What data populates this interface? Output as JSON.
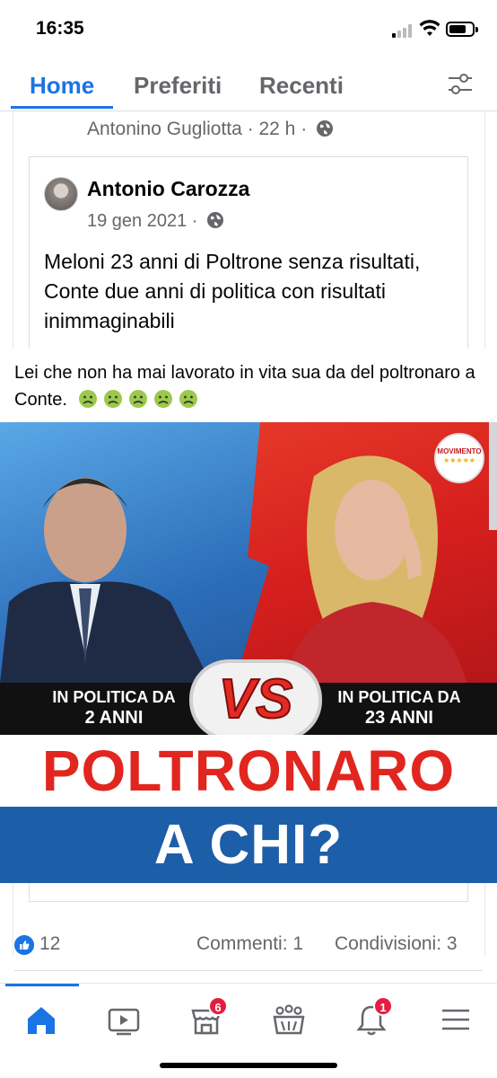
{
  "status_bar": {
    "time": "16:35"
  },
  "tabs": {
    "items": [
      {
        "label": "Home",
        "active": true
      },
      {
        "label": "Preferiti",
        "active": false
      },
      {
        "label": "Recenti",
        "active": false
      }
    ],
    "filter_icon": "sliders-icon"
  },
  "post": {
    "sharer": "Antonino Gugliotta",
    "sharer_time": "22 h",
    "shared": {
      "author": "Antonio Carozza",
      "date": "19 gen 2021",
      "text": "Meloni 23 anni di Poltrone senza risultati, Conte due anni di politica con risultati inimmaginabili",
      "caption": "Lei che non ha mai lavorato in vita sua da del poltronaro a Conte.",
      "caption_emoji_count": 5,
      "image": {
        "left_line1": "IN POLITICA DA",
        "left_line2": "2 ANNI",
        "right_line1": "IN POLITICA DA",
        "right_line2": "23 ANNI",
        "vs": "VS",
        "headline1": "POLTRONARO",
        "headline2": "A CHI?",
        "logo_text": "MOVIMENTO"
      }
    },
    "reactions": {
      "likes": "12",
      "comments": "Commenti: 1",
      "shares": "Condivisioni: 3"
    }
  },
  "bottom_nav": {
    "items": [
      {
        "icon": "home-icon",
        "active": true
      },
      {
        "icon": "video-icon"
      },
      {
        "icon": "marketplace-icon",
        "badge": "6"
      },
      {
        "icon": "groups-icon"
      },
      {
        "icon": "bell-icon",
        "badge": "1"
      },
      {
        "icon": "menu-icon"
      }
    ]
  },
  "colors": {
    "accent": "#1b74e4",
    "badge": "#e41e3f",
    "meme_red": "#e0261f",
    "meme_blue": "#1d5ea8"
  }
}
